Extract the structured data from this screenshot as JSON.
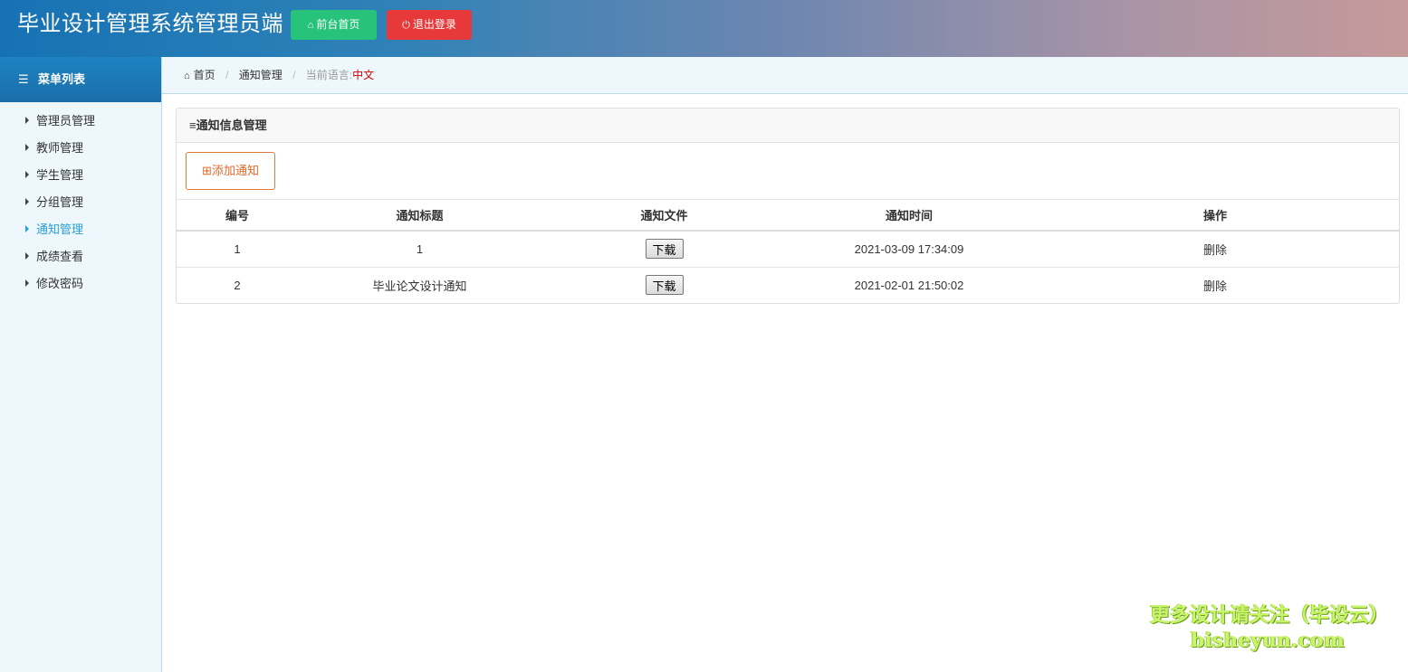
{
  "header": {
    "title": "毕业设计管理系统管理员端",
    "home_button": "前台首页",
    "logout_button": "退出登录"
  },
  "sidebar": {
    "heading": "菜单列表",
    "items": [
      {
        "label": "管理员管理",
        "active": false
      },
      {
        "label": "教师管理",
        "active": false
      },
      {
        "label": "学生管理",
        "active": false
      },
      {
        "label": "分组管理",
        "active": false
      },
      {
        "label": "通知管理",
        "active": true
      },
      {
        "label": "成绩查看",
        "active": false
      },
      {
        "label": "修改密码",
        "active": false
      }
    ]
  },
  "breadcrumb": {
    "home": "首页",
    "current": "通知管理",
    "lang_label": "当前语言:",
    "lang_value": "中文"
  },
  "panel": {
    "title": "通知信息管理",
    "add_button": "添加通知",
    "columns": [
      "编号",
      "通知标题",
      "通知文件",
      "通知时间",
      "操作"
    ],
    "rows": [
      {
        "id": "1",
        "title": "1",
        "file_button": "下载",
        "time": "2021-03-09 17:34:09",
        "action": "删除"
      },
      {
        "id": "2",
        "title": "毕业论文设计通知",
        "file_button": "下载",
        "time": "2021-02-01 21:50:02",
        "action": "删除"
      }
    ]
  },
  "watermark": {
    "line1": "更多设计请关注（毕设云）",
    "line2": "bisheyun.com"
  },
  "colors": {
    "home_button": "#27c37a",
    "logout_button": "#e8393a",
    "active_menu": "#2a9ed6",
    "add_button_border": "#e07a3d",
    "lang_value": "#cc0000"
  }
}
